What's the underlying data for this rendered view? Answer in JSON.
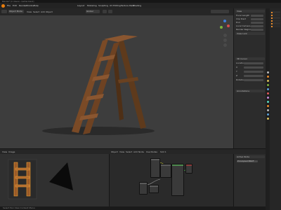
{
  "window": {
    "title": "Blender* [C:\\Users\\...\\ladder.blend]"
  },
  "menu": {
    "items": [
      "File",
      "Edit",
      "Render",
      "Window",
      "Help",
      "Layout",
      "Modeling",
      "Sculpting",
      "UV Editing",
      "Texture Paint",
      "Shading"
    ]
  },
  "viewport": {
    "mode": "Object Mode",
    "view": "View",
    "select": "Select",
    "add": "Add",
    "object": "Object",
    "transform": "Global"
  },
  "gizmo": {
    "x_label": "X",
    "y_label": "Y",
    "z_label": "Z",
    "x_color": "#d64c4c",
    "y_color": "#7db33a",
    "z_color": "#3d7ddb"
  },
  "sidebar": {
    "tabs": [
      "Item",
      "Tool",
      "View"
    ],
    "view_section": "View",
    "rows": [
      "Focal Length",
      "Clip Start",
      "End",
      "Local Camera",
      "Render Region"
    ],
    "view_lock": "View Lock",
    "lock_section": "3D Cursor",
    "cursor_rows": [
      "Location",
      "X",
      "Y",
      "Z",
      "Rotation"
    ],
    "annotations": "Annotations"
  },
  "bottom": {
    "image_editor": {
      "view": "View",
      "image": "Image"
    },
    "node_editor": {
      "object": "Object",
      "view": "View",
      "select": "Select",
      "add": "Add",
      "node": "Node",
      "use_nodes": "Use Nodes",
      "slot": "Slot 1"
    },
    "node_side": {
      "section": "Active Node",
      "node_label": "Principled BSDF"
    }
  },
  "status": {
    "text": "Select   Pan View   Context Menu"
  },
  "colors": {
    "ladder_wood": "#7a4a26",
    "ladder_dark": "#4a2a14",
    "accent_orange": "#e88a2a",
    "selection_outline": "#f0a030"
  }
}
